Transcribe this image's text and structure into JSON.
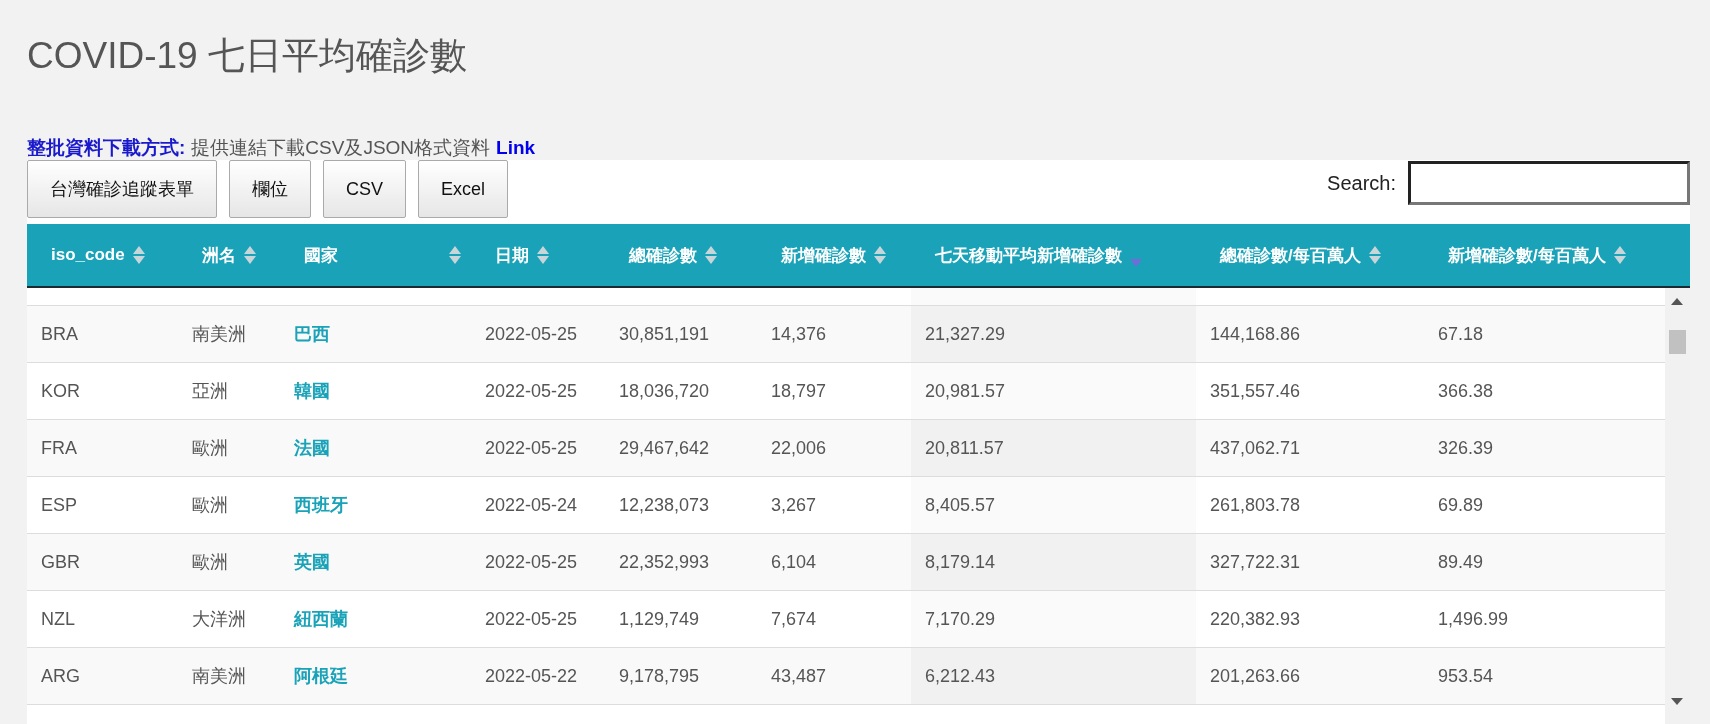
{
  "title": "COVID-19 七日平均確診數",
  "download": {
    "label": "整批資料下載方式:",
    "text": "提供連結下載CSV及JSON格式資料",
    "link": "Link"
  },
  "buttons": [
    "台灣確診追蹤表單",
    "欄位",
    "CSV",
    "Excel"
  ],
  "search": {
    "label": "Search:"
  },
  "table": {
    "columns": [
      {
        "label": "iso_code",
        "sorted": false
      },
      {
        "label": "洲名",
        "sorted": false
      },
      {
        "label": "國家",
        "sorted": false
      },
      {
        "label": "日期",
        "sorted": false
      },
      {
        "label": "總確診數",
        "sorted": false
      },
      {
        "label": "新增確診數",
        "sorted": false
      },
      {
        "label": "七天移動平均新增確診數",
        "sorted": true
      },
      {
        "label": "總確診數/每百萬人",
        "sorted": false
      },
      {
        "label": "新增確診數/每百萬人",
        "sorted": false
      }
    ],
    "rows": [
      [
        "BRA",
        "南美洲",
        "巴西",
        "2022-05-25",
        "30,851,191",
        "14,376",
        "21,327.29",
        "144,168.86",
        "67.18"
      ],
      [
        "KOR",
        "亞洲",
        "韓國",
        "2022-05-25",
        "18,036,720",
        "18,797",
        "20,981.57",
        "351,557.46",
        "366.38"
      ],
      [
        "FRA",
        "歐洲",
        "法國",
        "2022-05-25",
        "29,467,642",
        "22,006",
        "20,811.57",
        "437,062.71",
        "326.39"
      ],
      [
        "ESP",
        "歐洲",
        "西班牙",
        "2022-05-24",
        "12,238,073",
        "3,267",
        "8,405.57",
        "261,803.78",
        "69.89"
      ],
      [
        "GBR",
        "歐洲",
        "英國",
        "2022-05-25",
        "22,352,993",
        "6,104",
        "8,179.14",
        "327,722.31",
        "89.49"
      ],
      [
        "NZL",
        "大洋洲",
        "紐西蘭",
        "2022-05-25",
        "1,129,749",
        "7,674",
        "7,170.29",
        "220,382.93",
        "1,496.99"
      ],
      [
        "ARG",
        "南美洲",
        "阿根廷",
        "2022-05-22",
        "9,178,795",
        "43,487",
        "6,212.43",
        "201,263.66",
        "953.54"
      ]
    ]
  }
}
